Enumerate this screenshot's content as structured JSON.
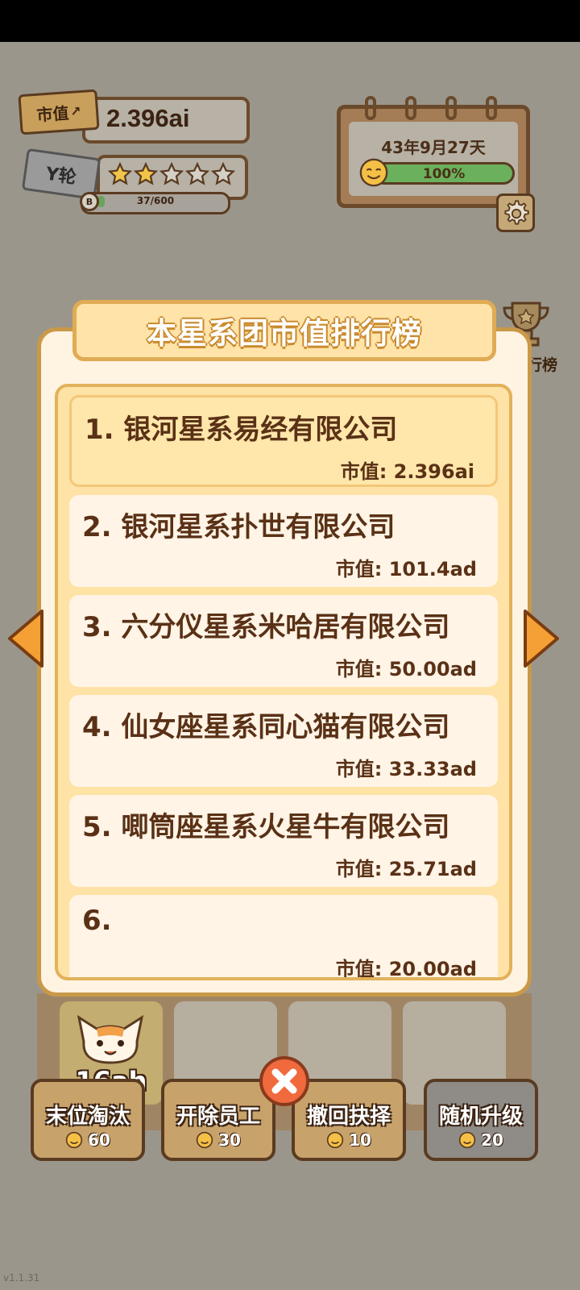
{
  "hud": {
    "market_value_tag": "市值",
    "market_value": "2.396ai",
    "round_tag": "Y轮",
    "stars_filled": 2,
    "stars_total": 5,
    "xp_badge": "B",
    "xp_text": "37/600",
    "xp_progress": 0.06
  },
  "calendar": {
    "date": "43年9月27天",
    "mood_percent_label": "100%",
    "mood_percent": 1.0
  },
  "side": {
    "trophy_label": "行榜"
  },
  "modal": {
    "title": "本星系团市值排行榜",
    "rows": [
      {
        "name": "1. 银河星系易经有限公司",
        "value": "市值: 2.396ai"
      },
      {
        "name": "2. 银河星系扑世有限公司",
        "value": "市值: 101.4ad"
      },
      {
        "name": "3. 六分仪星系米哈居有限公司",
        "value": "市值: 50.00ad"
      },
      {
        "name": "4. 仙女座星系同心猫有限公司",
        "value": "市值: 33.33ad"
      },
      {
        "name": "5. 唧筒座星系火星牛有限公司",
        "value": "市值: 25.71ad"
      },
      {
        "name": "6.",
        "value": "市值: 20.00ad"
      }
    ]
  },
  "board": {
    "cat_level": "16ah"
  },
  "actions": [
    {
      "label": "末位淘汰",
      "cost": "60"
    },
    {
      "label": "开除员工",
      "cost": "30"
    },
    {
      "label": "撤回抉择",
      "cost": "10"
    },
    {
      "label": "随机升级",
      "cost": "20"
    }
  ],
  "version": "v1.1.31",
  "colors": {
    "background": "#9b968b",
    "modal_bg": "#fff3e2",
    "accent_orange": "#f39a2e",
    "text_brown": "#5a3116"
  }
}
